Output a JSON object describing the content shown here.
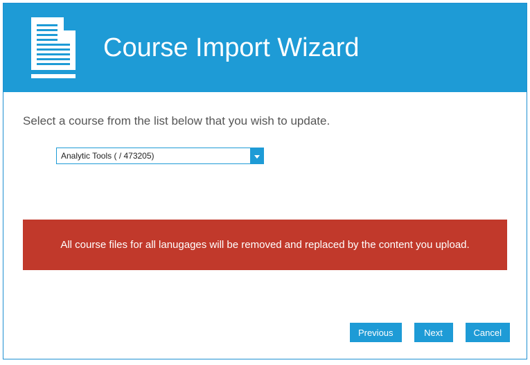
{
  "header": {
    "title": "Course Import Wizard"
  },
  "body": {
    "instruction": "Select a course from the list below that you wish to update.",
    "selected_course": "Analytic Tools ( / 473205)",
    "warning": "All course files for all lanugages will be removed and replaced by the content you upload."
  },
  "buttons": {
    "previous": "Previous",
    "next": "Next",
    "cancel": "Cancel"
  }
}
